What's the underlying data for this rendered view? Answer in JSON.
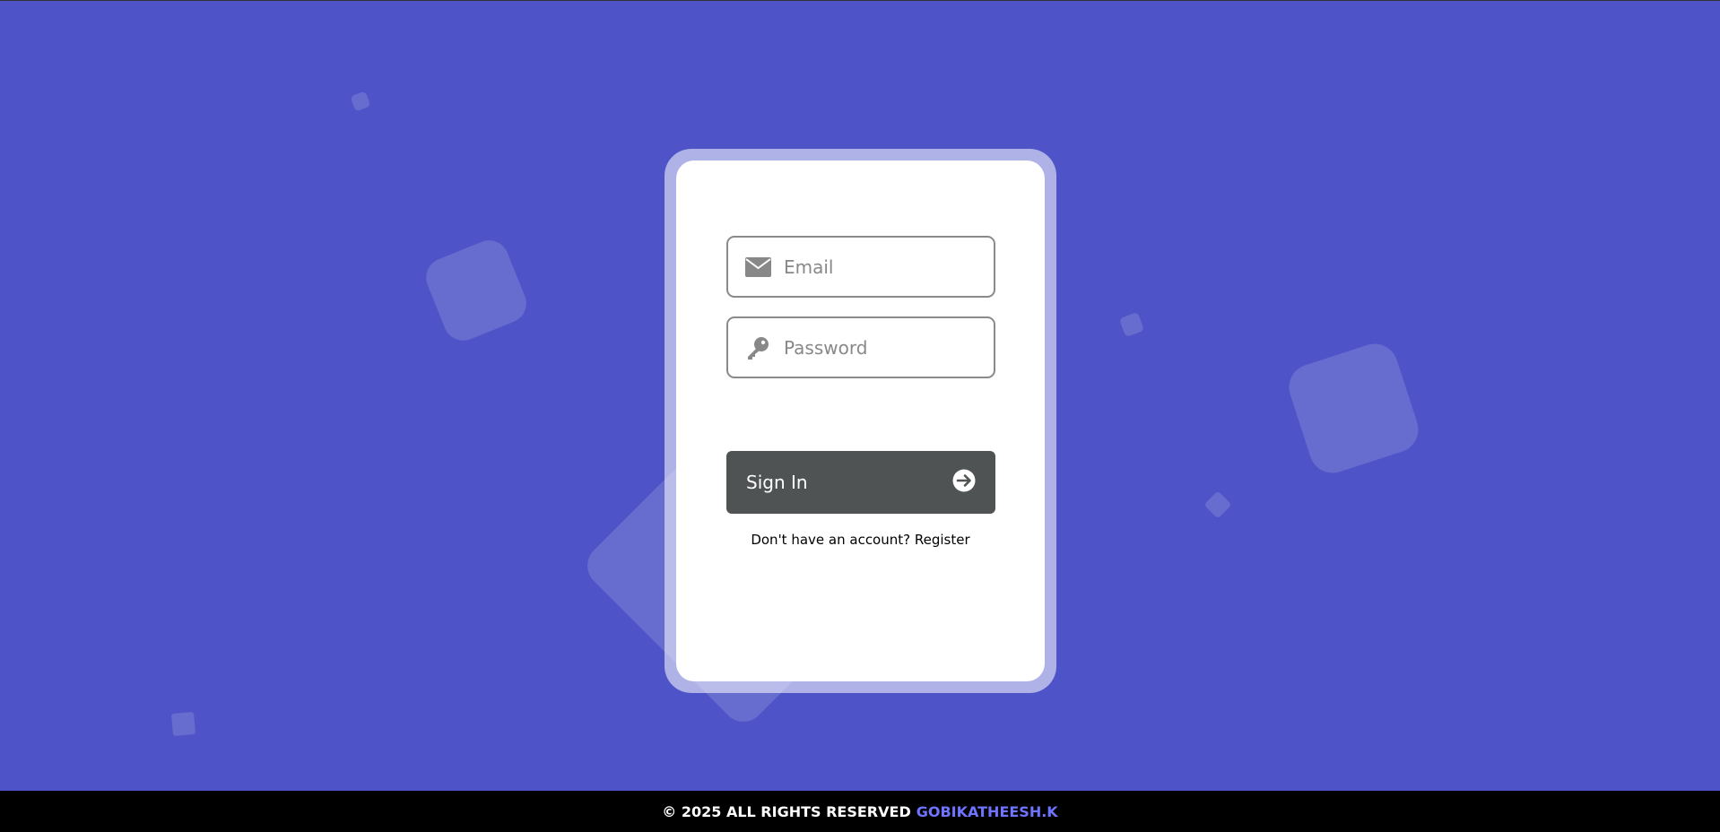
{
  "login": {
    "email_placeholder": "Email",
    "password_placeholder": "Password",
    "sign_in_label": "Sign In",
    "register_prompt": "Don't have an account?",
    "register_link": "Register"
  },
  "footer": {
    "copyright": "© 2025 ALL RIGHTS RESERVED",
    "author": "GOBIKATHEESH.K"
  },
  "colors": {
    "background": "#4e54c8",
    "button": "#505353",
    "author": "#6e74ff"
  }
}
